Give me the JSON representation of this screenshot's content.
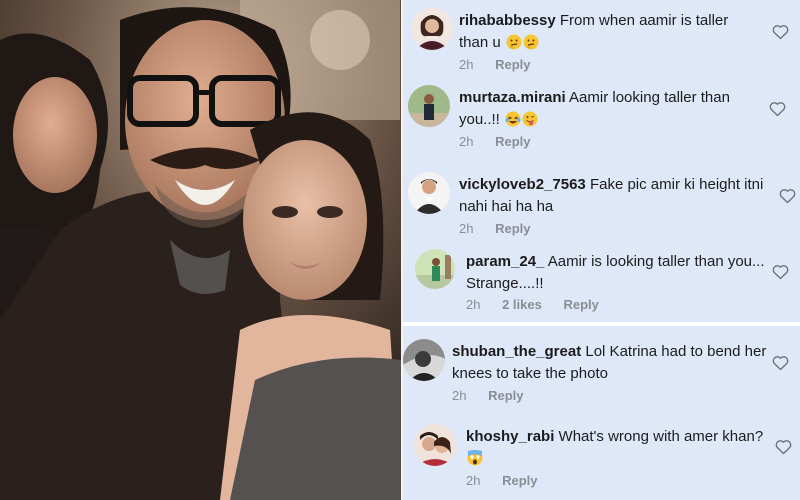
{
  "photo": {
    "description_icon": "selfie-photo"
  },
  "comments": [
    {
      "user": "rihababbessy",
      "text": "From when aamir is taller than u",
      "emojis": [
        "thinking-face-emoji",
        "thinking-face-emoji"
      ],
      "time": "2h",
      "likes": "",
      "reply": "Reply"
    },
    {
      "user": "murtaza.mirani",
      "text": "Aamir looking taller than you..!!",
      "emojis": [
        "laughing-tears-emoji",
        "tongue-out-emoji"
      ],
      "time": "2h",
      "likes": "",
      "reply": "Reply"
    },
    {
      "user": "vickyloveb2_7563",
      "text": "Fake pic amir ki height itni nahi hai ha ha",
      "emojis": [],
      "time": "2h",
      "likes": "",
      "reply": "Reply"
    },
    {
      "user": "param_24_",
      "text": "Aamir is looking taller than you... Strange....!!",
      "emojis": [],
      "time": "2h",
      "likes": "2 likes",
      "reply": "Reply"
    },
    {
      "user": "shuban_the_great",
      "text": "Lol Katrina had to bend her knees to take the photo",
      "emojis": [],
      "time": "2h",
      "likes": "",
      "reply": "Reply"
    },
    {
      "user": "khoshy_rabi",
      "text": "What's wrong with amer khan?",
      "emojis": [
        "screaming-face-emoji"
      ],
      "time": "2h",
      "likes": "",
      "reply": "Reply"
    }
  ],
  "colors": {
    "panel_bg": "#dfe8f8",
    "meta_text": "#8a8e94",
    "heart_stroke": "#6d7178"
  }
}
